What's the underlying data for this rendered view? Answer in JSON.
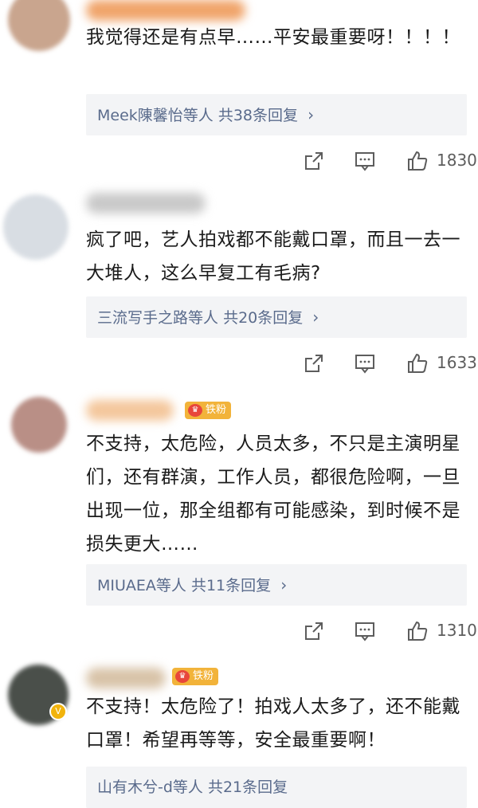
{
  "comments": [
    {
      "text": "我觉得还是有点早……平安最重要呀！！！！",
      "replies_names": "Meek陳馨怡等人",
      "replies_count": "共38条回复",
      "likes": "1830"
    },
    {
      "text": "疯了吧，艺人拍戏都不能戴口罩，而且一去一大堆人，这么早复工有毛病?",
      "replies_names": "三流写手之路等人",
      "replies_count": "共20条回复",
      "likes": "1633"
    },
    {
      "badge": "铁粉",
      "text": "不支持，太危险，人员太多，不只是主演明星们，还有群演，工作人员，都很危险啊，一旦出现一位，那全组都有可能感染，到时候不是损失更大……",
      "replies_names": "MIUAEA等人",
      "replies_count": "共11条回复",
      "likes": "1310"
    },
    {
      "badge": "铁粉",
      "text": "不支持！太危险了！拍戏人太多了，还不能戴口罩！希望再等等，安全最重要啊！",
      "replies_names": "山有木兮-d等人",
      "replies_count": "共21条回复"
    }
  ],
  "icons": {
    "share": "share-icon",
    "comment": "comment-icon",
    "like": "like-icon",
    "chevron": "chevron-right-icon",
    "verified": "verified-icon"
  },
  "colors": {
    "reply_link": "#5a6b8c",
    "reply_bg": "#f3f4f6",
    "badge": "#f2b33a",
    "icon": "#5d5d5d"
  }
}
